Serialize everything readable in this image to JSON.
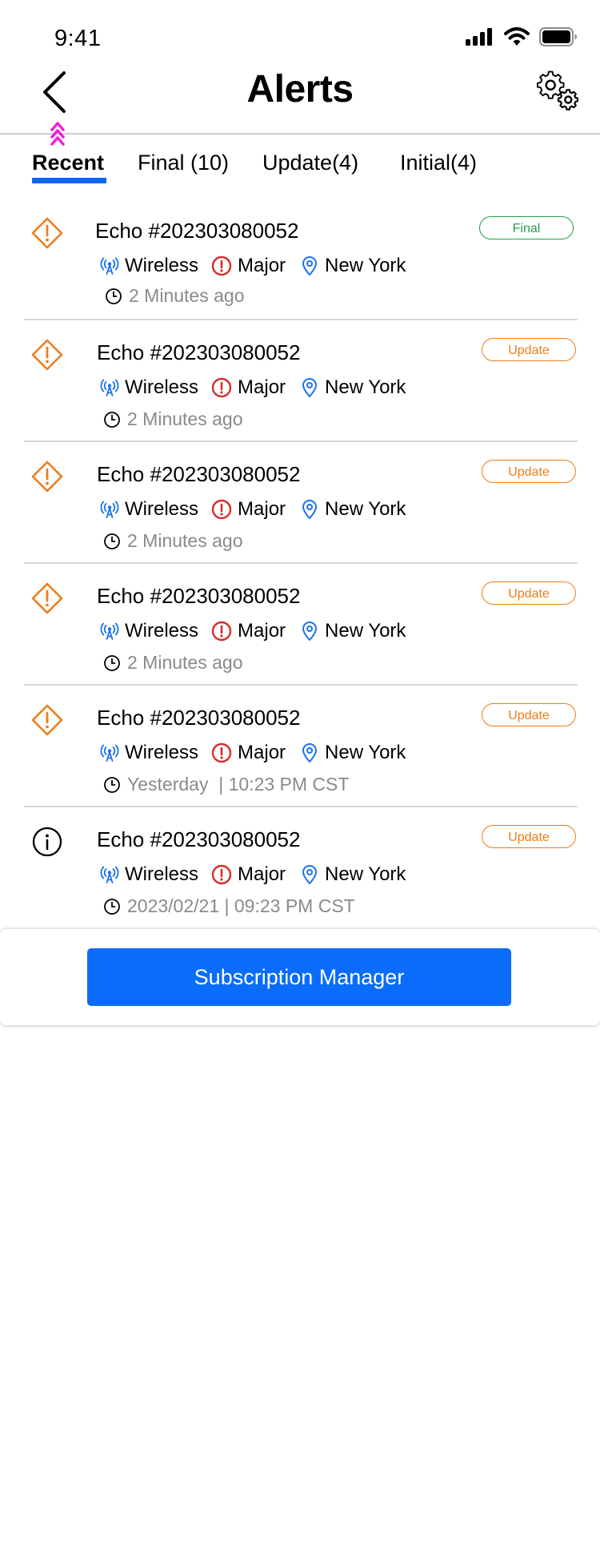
{
  "status_bar": {
    "time": "9:41",
    "icons": [
      "signal-icon",
      "wifi-icon",
      "battery-icon"
    ]
  },
  "header": {
    "title": "Alerts",
    "back_icon": "chevron-left-icon",
    "settings_icon": "gears-icon"
  },
  "tabs": [
    {
      "label": "Recent",
      "active": true
    },
    {
      "label": "Final (10)",
      "active": false
    },
    {
      "label": "Update(4)",
      "active": false
    },
    {
      "label": "Initial(4)",
      "active": false
    }
  ],
  "colors": {
    "accent_blue": "#0a66f5",
    "warning_orange": "#ee7d1b",
    "final_green": "#22a04b",
    "major_red": "#d92c2c",
    "muted_gray": "#8a8a8a"
  },
  "alerts": [
    {
      "icon": "warning-diamond-icon",
      "title": "Echo #202303080052",
      "status": "Final",
      "type": "Wireless",
      "severity": "Major",
      "location": "New York",
      "time": "2 Minutes ago"
    },
    {
      "icon": "warning-diamond-icon",
      "title": "Echo #202303080052",
      "status": "Update",
      "type": "Wireless",
      "severity": "Major",
      "location": "New York",
      "time": "2 Minutes ago"
    },
    {
      "icon": "warning-diamond-icon",
      "title": "Echo #202303080052",
      "status": "Update",
      "type": "Wireless",
      "severity": "Major",
      "location": "New York",
      "time": "2 Minutes ago"
    },
    {
      "icon": "warning-diamond-icon",
      "title": "Echo #202303080052",
      "status": "Update",
      "type": "Wireless",
      "severity": "Major",
      "location": "New York",
      "time": "2 Minutes ago"
    },
    {
      "icon": "warning-diamond-icon",
      "title": "Echo #202303080052",
      "status": "Update",
      "type": "Wireless",
      "severity": "Major",
      "location": "New York",
      "time": "Yesterday  | 10:23 PM CST"
    },
    {
      "icon": "info-circle-icon",
      "title": "Echo #202303080052",
      "status": "Update",
      "type": "Wireless",
      "severity": "Major",
      "location": "New York",
      "time": "2023/02/21 | 09:23 PM CST"
    }
  ],
  "footer": {
    "button_label": "Subscription Manager"
  }
}
